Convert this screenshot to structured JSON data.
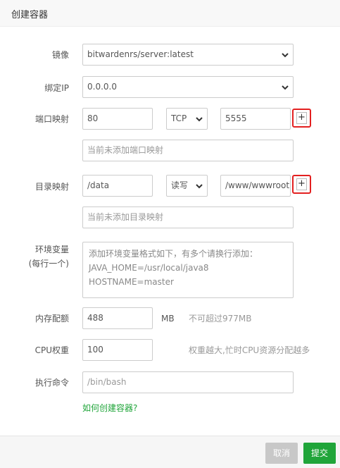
{
  "dialog": {
    "title": "创建容器"
  },
  "form": {
    "image": {
      "label": "镜像",
      "value": "bitwardenrs/server:latest"
    },
    "bind_ip": {
      "label": "绑定IP",
      "value": "0.0.0.0"
    },
    "port_map": {
      "label": "端口映射",
      "container_port": "80",
      "protocol": "TCP",
      "host_port": "5555",
      "add_symbol": "+",
      "empty_text": "当前未添加端口映射"
    },
    "dir_map": {
      "label": "目录映射",
      "container_path": "/data",
      "mode": "读写",
      "host_path": "/www/wwwroot",
      "add_symbol": "+",
      "empty_text": "当前未添加目录映射"
    },
    "env": {
      "label_line1": "环境变量",
      "label_line2": "(每行一个)",
      "placeholder_line1": "添加环境变量格式如下，有多个请换行添加：",
      "placeholder_line2": "JAVA_HOME=/usr/local/java8",
      "placeholder_line3": "HOSTNAME=master"
    },
    "memory": {
      "label": "内存配额",
      "value": "488",
      "unit": "MB",
      "hint": "不可超过977MB"
    },
    "cpu": {
      "label": "CPU权重",
      "value": "100",
      "hint": "权重越大,忙时CPU资源分配越多"
    },
    "command": {
      "label": "执行命令",
      "placeholder": "/bin/bash"
    },
    "help_link": "如何创建容器?"
  },
  "footer": {
    "cancel_label": "取消",
    "submit_label": "提交"
  },
  "colors": {
    "accent": "#20a53a",
    "highlight": "#e32020",
    "cancel": "#c8c8c8"
  },
  "icons": {
    "select_arrow": "chevron-down-icon",
    "add": "plus-icon"
  }
}
